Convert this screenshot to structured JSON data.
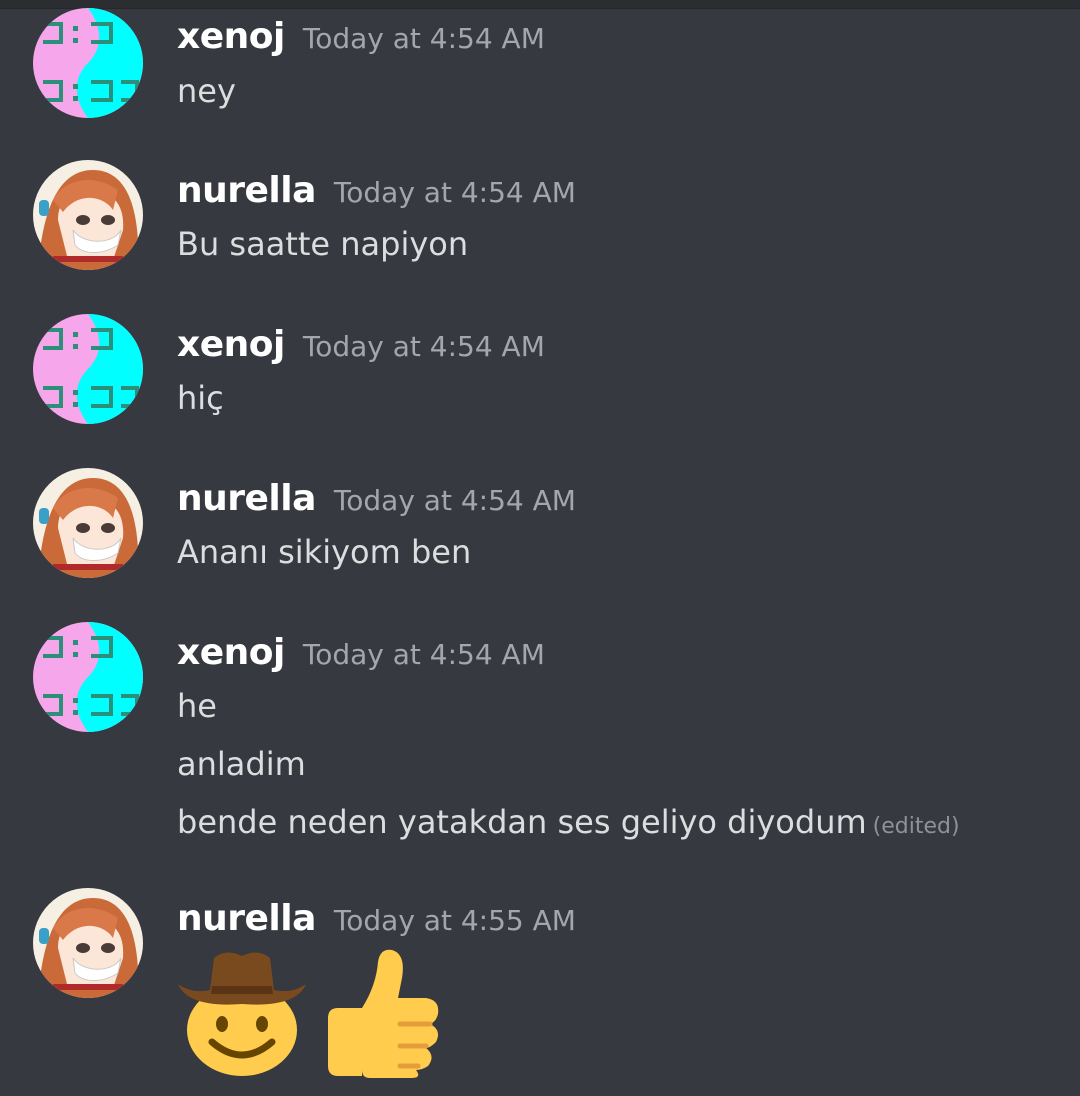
{
  "messages": [
    {
      "author": "xenoj",
      "timestamp": "Today at 4:54 AM",
      "avatar": "digital-clock-avatar",
      "lines": [
        "ney"
      ]
    },
    {
      "author": "nurella",
      "timestamp": "Today at 4:54 AM",
      "avatar": "anime-girl-avatar",
      "lines": [
        "Bu saatte napiyon"
      ]
    },
    {
      "author": "xenoj",
      "timestamp": "Today at 4:54 AM",
      "avatar": "digital-clock-avatar",
      "lines": [
        "hiç"
      ]
    },
    {
      "author": "nurella",
      "timestamp": "Today at 4:54 AM",
      "avatar": "anime-girl-avatar",
      "lines": [
        "Ananı sikiyom ben"
      ]
    },
    {
      "author": "xenoj",
      "timestamp": "Today at 4:54 AM",
      "avatar": "digital-clock-avatar",
      "lines": [
        "he",
        "anladim",
        "bende neden yatakdan ses geliyo diyodum"
      ],
      "edited_label": "(edited)"
    },
    {
      "author": "nurella",
      "timestamp": "Today at 4:55 AM",
      "avatar": "anime-girl-avatar",
      "emojis": [
        "cowboy-face-emoji",
        "thumbs-up-emoji"
      ]
    }
  ]
}
